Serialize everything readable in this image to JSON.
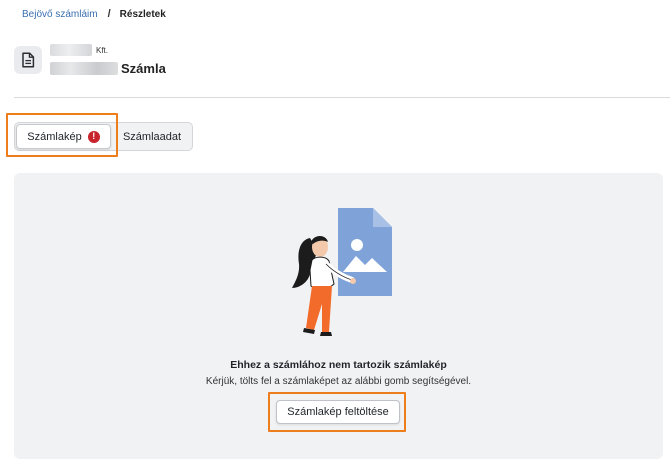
{
  "breadcrumb": {
    "parent_label": "Bejövő számláim",
    "separator": "/",
    "current_label": "Részletek"
  },
  "header": {
    "company_suffix": "Kft.",
    "doc_type_label": "Számla",
    "icon": "document-icon"
  },
  "tabs": [
    {
      "label": "Számlakép",
      "active": true,
      "badge": "!"
    },
    {
      "label": "Számlaadat",
      "active": false
    }
  ],
  "empty_state": {
    "title": "Ehhez a számlához nem tartozik számlakép",
    "subtitle": "Kérjük, tölts fel a számlaképet az alábbi gomb segítségével.",
    "upload_button_label": "Számlakép feltöltése"
  },
  "colors": {
    "highlight": "#ee7d1c",
    "error_badge": "#c8242b",
    "link": "#3a6fb0",
    "illustration_doc": "#7fa2d8",
    "illustration_pants": "#f26b2a"
  }
}
